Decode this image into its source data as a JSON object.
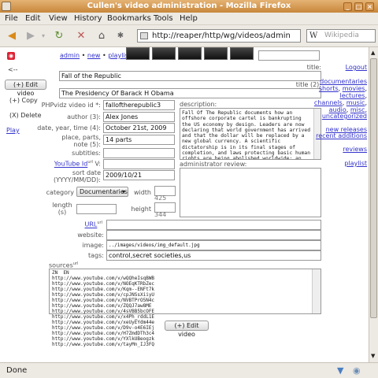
{
  "window": {
    "title": "Cullen's video administration - Mozilla Firefox"
  },
  "menu": [
    "File",
    "Edit",
    "View",
    "History",
    "Bookmarks",
    "Tools",
    "Help"
  ],
  "nav": {
    "url": "http://reaper/http/wg/videos/admin",
    "search_placeholder": "Wikipedia",
    "search_engine": "W"
  },
  "left": {
    "back": "<--",
    "edit_video": "(+) Edit video",
    "copy": "(+) Copy",
    "delete": "(X) Delete",
    "play": "Play"
  },
  "top_links": {
    "admin": "admin",
    "sep1": "•",
    "new": "new",
    "sep2": "•",
    "playlist": "playlist"
  },
  "form": {
    "title_label": "title:",
    "title_value": "Fall of the Republic",
    "title2_label": "title (2):",
    "title2_value": "The Presidency Of Barack H Obama",
    "phpvidz_label": "PHPvidz video id *:",
    "phpvidz_value": "falloftherepublic3",
    "author_label": "author (3):",
    "author_value": "Alex Jones",
    "date_label": "date, year, time (4):",
    "date_value": "October 21st, 2009",
    "place_label": "place, parts, note (5):",
    "place_value": "14 parts",
    "subtitles_label": "subtitles:",
    "subtitles_value": "",
    "youtube_label": "YouTube Id",
    "youtube_sup": "url",
    "youtube_suffix": "V:",
    "youtube_value": "",
    "sort_label": "sort date (YYYY/MM/DD):",
    "sort_value": "2009/10/21",
    "category_label": "category",
    "category_value": "Documentaries",
    "width_label": "width",
    "width_hint": "425",
    "length_label": "length (s)",
    "height_label": "height",
    "height_hint": "344",
    "description_label": "description:",
    "description_value": "Fall Of The Republic documents how an offshore corporate cartel is bankrupting the US economy by design. Leaders are now declaring that world government has arrived and that the dollar will be replaced by a new global currency. A scientific dictatorship is in its final stages of completion, and laws protecting basic human rights are being abolished worldwide; an iron curtain of high-tech tyranny is now descending upon the planet. A worldwide revolt controlled by",
    "admin_review_label": "administrator review:",
    "url_label": "URL",
    "url_sup": "url",
    "url_value": "",
    "website_label": "website:",
    "website_value": "",
    "image_label": "image:",
    "image_value": "../images/videos/img_default.jpg",
    "tags_label": "tags:",
    "tags_value": "control,secret societies,us",
    "sources_label": "sources",
    "sources_sup": "url",
    "sources_lines": [
      "ZN  EN",
      "http://www.youtube.com/v/wQQheIsqBWB",
      "http://www.youtube.com/v/NOEqKTRbZec",
      "http://www.youtube.com/v/Kqm--ENFt7k",
      "http://www.youtube.com/v/cpJNSsXiiyU",
      "http://www.youtube.com/v/NVBTPrO5N4c",
      "http://www.youtube.com/v/ZQQJ7aw8ME",
      "http://www.youtube.com/v/4sVBB5bcOFE",
      "http://www.youtube.com/v/x4Ph_rddL1E",
      "http://www.youtube.com/v/xeUyEYdm44e",
      "http://www.youtube.com/v/D9v-o4E6IEj",
      "http://www.youtube.com/v/H7ZmdDTh3c4",
      "http://www.youtube.com/v/YXlkUBeogzk",
      "http://www.youtube.com/v/tayMn_IJ3FQ"
    ],
    "submit": "(+) Edit video"
  },
  "right": {
    "logout": "Logout",
    "documentaries": "documentaries",
    "shorts": "shorts",
    "movies": "movies",
    "lectures": "lectures",
    "channels": "channels",
    "music": "music",
    "audio": "audio",
    "misc": "misc",
    "uncategorized": "uncategorized",
    "new_releases": "new releases",
    "recent_additions": "recent additions",
    "reviews": "reviews",
    "playlist": "playlist"
  },
  "status": {
    "text": "Done"
  }
}
